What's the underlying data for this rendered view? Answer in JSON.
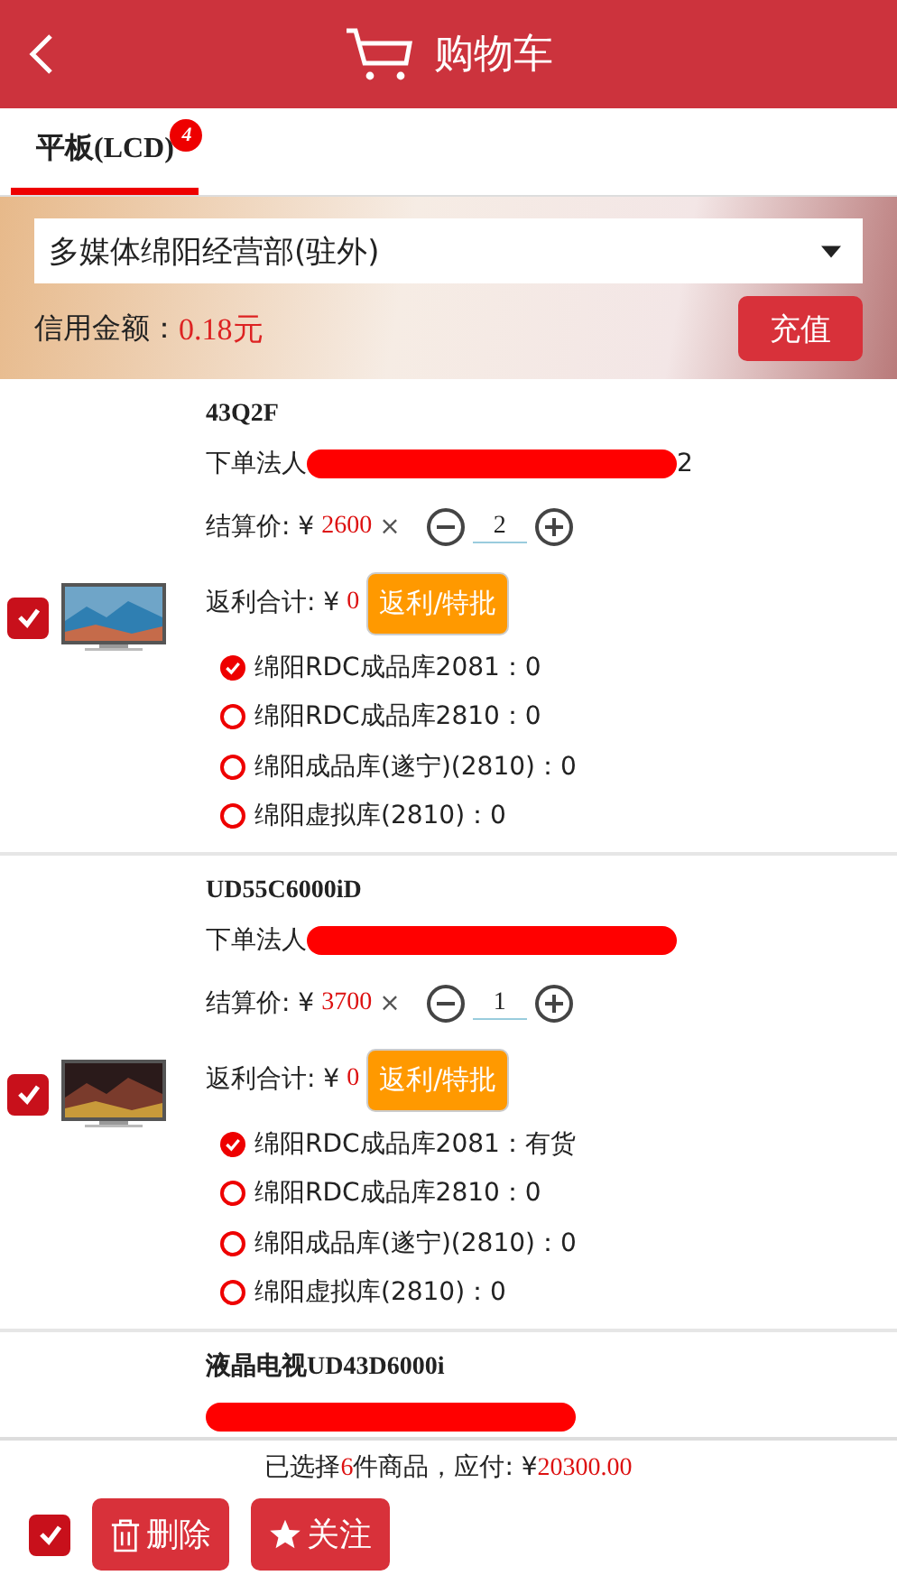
{
  "header": {
    "title": "购物车"
  },
  "tabs": [
    {
      "label": "平板(LCD)",
      "badge": "4",
      "selected": true
    }
  ],
  "account": {
    "value": "多媒体绵阳经营部(驻外)",
    "credit_label": "信用金额：",
    "credit_value": "0.18元",
    "recharge_button": "充值"
  },
  "items": [
    {
      "checked": true,
      "name": "43Q2F",
      "order_label": "下单法人",
      "order_tail": "2",
      "price_label": "结算价: ¥",
      "price": "2600",
      "times": "×",
      "quantity": "2",
      "rebate_label": "返利合计: ¥",
      "rebate": "0",
      "rebate_button": "返利/特批",
      "warehouses": [
        {
          "label": "绵阳RDC成品库2081：",
          "stock": "0",
          "selected": true
        },
        {
          "label": "绵阳RDC成品库2810：",
          "stock": "0",
          "selected": false
        },
        {
          "label": "绵阳成品库(遂宁)(2810)：",
          "stock": "0",
          "selected": false
        },
        {
          "label": "绵阳虚拟库(2810)：",
          "stock": "0",
          "selected": false
        }
      ]
    },
    {
      "checked": true,
      "name": "UD55C6000iD",
      "order_label": "下单法人",
      "price_label": "结算价: ¥",
      "price": "3700",
      "times": "×",
      "quantity": "1",
      "rebate_label": "返利合计: ¥",
      "rebate": "0",
      "rebate_button": "返利/特批",
      "warehouses": [
        {
          "label": "绵阳RDC成品库2081：",
          "stock": "有货",
          "selected": true
        },
        {
          "label": "绵阳RDC成品库2810：",
          "stock": "0",
          "selected": false
        },
        {
          "label": "绵阳成品库(遂宁)(2810)：",
          "stock": "0",
          "selected": false
        },
        {
          "label": "绵阳虚拟库(2810)：",
          "stock": "0",
          "selected": false
        }
      ]
    },
    {
      "name": "液晶电视UD43D6000i"
    }
  ],
  "footer": {
    "summary_prefix": "已选择",
    "count": "6",
    "summary_middle": "件商品，应付: ¥",
    "total": "20300.00",
    "select_all_checked": true,
    "delete_button": "删除",
    "follow_button": "关注"
  }
}
